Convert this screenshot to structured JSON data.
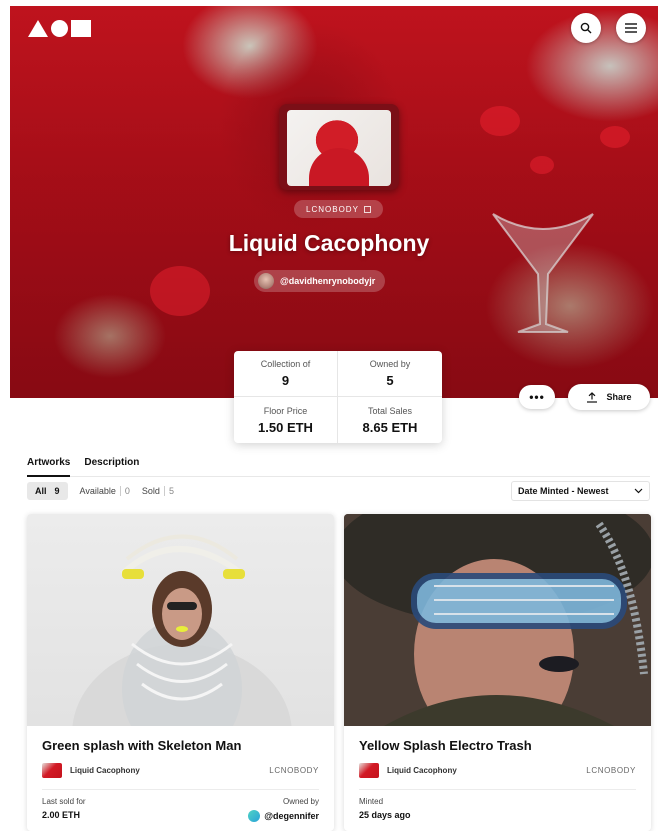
{
  "header": {
    "logo_icon": "aoi-logo-icon"
  },
  "collection": {
    "tag": "LCNOBODY",
    "title": "Liquid Cacophony",
    "creator_handle": "@davidhenrynobodyjr"
  },
  "stats": {
    "collection_of_label": "Collection of",
    "collection_of_value": "9",
    "owned_by_label": "Owned by",
    "owned_by_value": "5",
    "floor_price_label": "Floor Price",
    "floor_price_value": "1.50 ETH",
    "total_sales_label": "Total Sales",
    "total_sales_value": "8.65 ETH"
  },
  "actions": {
    "more_label": "•••",
    "share_label": "Share"
  },
  "tabs": [
    {
      "label": "Artworks"
    },
    {
      "label": "Description"
    }
  ],
  "filters": [
    {
      "label": "All",
      "count": "9"
    },
    {
      "label": "Available",
      "count": "0"
    },
    {
      "label": "Sold",
      "count": "5"
    }
  ],
  "sort": {
    "selected": "Date Minted - Newest"
  },
  "cards": [
    {
      "title": "Green splash with Skeleton Man",
      "collection": "Liquid Cacophony",
      "code": "LCNOBODY",
      "left_key": "Last sold for",
      "left_value": "2.00 ETH",
      "right_key": "Owned by",
      "right_value": "@degennifer"
    },
    {
      "title": "Yellow Splash Electro Trash",
      "collection": "Liquid Cacophony",
      "code": "LCNOBODY",
      "left_key": "Minted",
      "left_value": "25 days ago"
    }
  ],
  "colors": {
    "hero_red": "#c9141f",
    "accent": "#111111"
  }
}
